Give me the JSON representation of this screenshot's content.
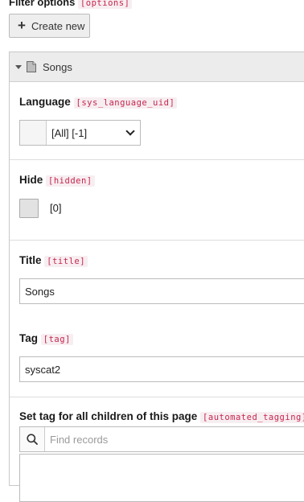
{
  "filter": {
    "label": "Filter options",
    "field": "[options]"
  },
  "create_button": {
    "label": "Create new"
  },
  "record": {
    "title": "Songs"
  },
  "language": {
    "label": "Language",
    "field": "[sys_language_uid]",
    "selected": "[All] [-1]"
  },
  "hide": {
    "label": "Hide",
    "field": "[hidden]",
    "value": "[0]"
  },
  "title_field": {
    "label": "Title",
    "field": "[title]",
    "value": "Songs"
  },
  "tag": {
    "label": "Tag",
    "field": "[tag]",
    "value": "syscat2"
  },
  "automated": {
    "label": "Set tag for all children of this page",
    "field": "[automated_tagging]",
    "search_placeholder": "Find records"
  },
  "icons": {
    "create": "plus-icon",
    "collapse": "caret-down-icon",
    "record": "document-icon",
    "search": "search-icon",
    "select": "chevron-down-icon"
  }
}
